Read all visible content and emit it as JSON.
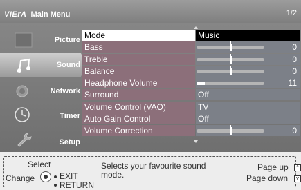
{
  "header": {
    "brand": "VIErA",
    "title": "Main Menu",
    "page": "1/2"
  },
  "sidebar": {
    "items": [
      {
        "label": "Picture",
        "icon": "picture-icon",
        "active": false
      },
      {
        "label": "Sound",
        "icon": "music-note-icon",
        "active": true
      },
      {
        "label": "Network",
        "icon": "globe-icon",
        "active": false
      },
      {
        "label": "Timer",
        "icon": "clock-icon",
        "active": false
      },
      {
        "label": "Setup",
        "icon": "wrench-icon",
        "active": false
      }
    ]
  },
  "menu": {
    "rows": [
      {
        "label": "Mode",
        "value": "Music",
        "selected": true
      },
      {
        "label": "Bass",
        "level": 0,
        "number": "0"
      },
      {
        "label": "Treble",
        "level": 0,
        "number": "0"
      },
      {
        "label": "Balance",
        "level": 0,
        "number": "0"
      },
      {
        "label": "Headphone Volume",
        "level": 0.11,
        "number": "11"
      },
      {
        "label": "Surround",
        "value": "Off"
      },
      {
        "label": "Volume Control (VAO)",
        "value": "TV"
      },
      {
        "label": "Auto Gain Control",
        "value": "Off"
      },
      {
        "label": "Volume Correction",
        "level": 0,
        "number": "0"
      }
    ]
  },
  "footer": {
    "select": "Select",
    "change": "Change",
    "exit": "EXIT",
    "return": "RETURN",
    "help": "Selects your favourite sound mode.",
    "page_up": "Page up",
    "page_down": "Page down",
    "page_up_icon": "^",
    "page_down_icon": "v"
  }
}
